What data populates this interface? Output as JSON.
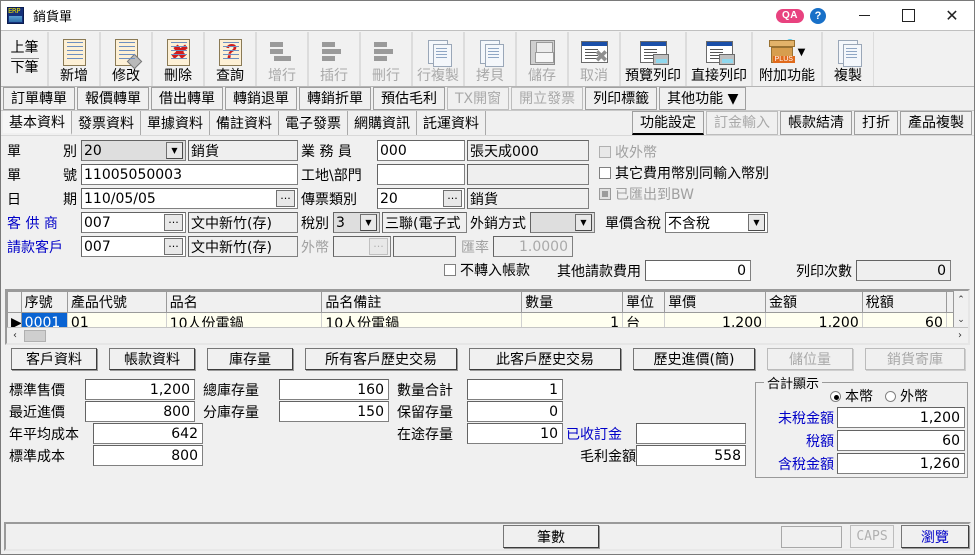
{
  "window": {
    "title": "銷貨單",
    "app_icon": "erp-logo-icon",
    "qa_badge": "QA",
    "help_badge": "?",
    "minimize": "–",
    "maximize": "□",
    "close": "✕"
  },
  "toolbar": [
    {
      "label_top": "上筆",
      "label_bottom": "下筆",
      "icon": "nav-prev-next-icon",
      "enabled": true,
      "kind": "nav"
    },
    {
      "label": "新增",
      "icon": "new-document-icon",
      "enabled": true,
      "kind": "doc"
    },
    {
      "label": "修改",
      "icon": "edit-document-icon",
      "enabled": true,
      "kind": "doc-pen"
    },
    {
      "label": "刪除",
      "icon": "delete-document-icon",
      "enabled": true,
      "kind": "doc-x"
    },
    {
      "label": "查詢",
      "icon": "query-document-icon",
      "enabled": true,
      "kind": "doc-q"
    },
    {
      "label": "增行",
      "icon": "add-row-icon",
      "enabled": false,
      "kind": "rows-add"
    },
    {
      "label": "插行",
      "icon": "insert-row-icon",
      "enabled": false,
      "kind": "rows-ins"
    },
    {
      "label": "刪行",
      "icon": "delete-row-icon",
      "enabled": false,
      "kind": "rows-del"
    },
    {
      "label": "行複製",
      "icon": "copy-row-icon",
      "enabled": false,
      "kind": "copy"
    },
    {
      "label": "拷貝",
      "icon": "clipboard-copy-icon",
      "enabled": false,
      "kind": "save-alt"
    },
    {
      "label": "儲存",
      "icon": "save-icon",
      "enabled": false,
      "kind": "save"
    },
    {
      "label": "取消",
      "icon": "cancel-icon",
      "enabled": false,
      "kind": "win-x"
    },
    {
      "label": "預覽列印",
      "icon": "print-preview-icon",
      "enabled": true,
      "kind": "win-print"
    },
    {
      "label": "直接列印",
      "icon": "print-direct-icon",
      "enabled": true,
      "kind": "win-print"
    },
    {
      "label": "附加功能",
      "icon": "addon-features-icon",
      "enabled": true,
      "kind": "box",
      "has_caret": true
    },
    {
      "label": "複製",
      "icon": "duplicate-icon",
      "enabled": true,
      "kind": "copy2"
    }
  ],
  "tabs_row1": [
    {
      "label": "訂單轉單",
      "enabled": true
    },
    {
      "label": "報價轉單",
      "enabled": true
    },
    {
      "label": "借出轉單",
      "enabled": true
    },
    {
      "label": "轉銷退單",
      "enabled": true
    },
    {
      "label": "轉銷折單",
      "enabled": true
    },
    {
      "label": "預估毛利",
      "enabled": true
    },
    {
      "label": "TX開窗",
      "enabled": false
    },
    {
      "label": "開立發票",
      "enabled": false
    },
    {
      "label": "列印標籤",
      "enabled": true
    },
    {
      "label": "其他功能 ▼",
      "enabled": true
    }
  ],
  "tabs_row2": [
    {
      "label": "基本資料",
      "active": true
    },
    {
      "label": "發票資料",
      "active": false
    },
    {
      "label": "單據資料",
      "active": false
    },
    {
      "label": "備註資料",
      "active": false
    },
    {
      "label": "電子發票",
      "active": false
    },
    {
      "label": "網購資訊",
      "active": false
    },
    {
      "label": "託運資料",
      "active": false
    }
  ],
  "tabs_row2_right": [
    {
      "label": "功能設定",
      "enabled": true
    },
    {
      "label": "訂金輸入",
      "enabled": false
    },
    {
      "label": "帳款結清",
      "enabled": true
    },
    {
      "label": "打折",
      "enabled": true
    },
    {
      "label": "產品複製",
      "enabled": true
    }
  ],
  "form": {
    "doc_type_label": "單　　　別",
    "doc_type_value": "20",
    "doc_type_name": "銷貨",
    "doc_no_label": "單　　　號",
    "doc_no_value": "11005050003",
    "date_label": "日　　　期",
    "date_value": "110/05/05",
    "customer_label": "客 供 商",
    "customer_code": "007",
    "customer_name": "文中新竹(存)",
    "biller_label": "請款客戶",
    "biller_code": "007",
    "biller_name": "文中新竹(存)",
    "salesperson_label": "業 務 員",
    "salesperson_code": "000",
    "salesperson_name": "張天成000",
    "site_label": "工地\\部門",
    "site_code": "",
    "site_name": "",
    "voucher_label": "傳票類別",
    "voucher_code": "20",
    "voucher_name": "銷貨",
    "tax_label": "稅別",
    "tax_code": "3",
    "tax_name": "三聯(電子式",
    "export_label": "外銷方式",
    "export_value": "",
    "currency_label": "外幣",
    "currency_value": "",
    "currency_name": "",
    "rate_label": "匯率",
    "rate_value": "1.0000",
    "price_tax_label": "單價含稅",
    "price_tax_value": "不含稅",
    "chk_recv_foreign": "收外幣",
    "chk_other_fee_currency": "其它費用幣別同輸入幣別",
    "chk_exported_bw": "已匯出到BW",
    "chk_no_transfer": "不轉入帳款",
    "other_fee_label": "其他請款費用",
    "other_fee_value": "0",
    "print_count_label": "列印次數",
    "print_count_value": "0"
  },
  "grid": {
    "columns": [
      "序號",
      "產品代號",
      "品名",
      "品名備註",
      "數量",
      "單位",
      "單價",
      "金額",
      "稅額"
    ],
    "rows": [
      {
        "marker": "▶",
        "seq": "0001",
        "product_code": "01",
        "product_name": "10人份電鍋",
        "product_note": "10人份電鍋",
        "qty": "1",
        "unit": "台",
        "price": "1,200",
        "amount": "1,200",
        "tax": "60"
      }
    ]
  },
  "action_buttons": [
    {
      "label": "客戶資料",
      "enabled": true
    },
    {
      "label": "帳款資料",
      "enabled": true
    },
    {
      "label": "庫存量",
      "enabled": true
    },
    {
      "label": "所有客戶歷史交易",
      "enabled": true
    },
    {
      "label": "此客戶歷史交易",
      "enabled": true
    },
    {
      "label": "歷史進價(簡)",
      "enabled": true
    },
    {
      "label": "儲位量",
      "enabled": false
    },
    {
      "label": "銷貨寄庫",
      "enabled": false
    }
  ],
  "bottom": {
    "std_price_label": "標準售價",
    "std_price_value": "1,200",
    "last_cost_label": "最近進價",
    "last_cost_value": "800",
    "avg_cost_label": "年平均成本",
    "avg_cost_value": "642",
    "std_cost_label": "標準成本",
    "std_cost_value": "800",
    "total_stock_label": "總庫存量",
    "total_stock_value": "160",
    "branch_stock_label": "分庫存量",
    "branch_stock_value": "150",
    "qty_total_label": "數量合計",
    "qty_total_value": "1",
    "reserved_label": "保留存量",
    "reserved_value": "0",
    "intransit_label": "在途存量",
    "intransit_value": "10",
    "deposit_label": "已收訂金",
    "deposit_value": "",
    "gross_profit_label": "毛利金額",
    "gross_profit_value": "558"
  },
  "totals": {
    "legend": "合計顯示",
    "radio_local": "本幣",
    "radio_foreign": "外幣",
    "selected": "本幣",
    "untaxed_label": "未稅金額",
    "untaxed_value": "1,200",
    "tax_label": "稅額",
    "tax_value": "60",
    "taxed_label": "含稅金額",
    "taxed_value": "1,260"
  },
  "statusbar": {
    "count_button": "筆數",
    "count_value": "",
    "caps": "CAPS",
    "browse": "瀏覽"
  },
  "colors": {
    "accent_blue": "#0000c8",
    "selection_blue": "#0a64d2",
    "grid_row_bg": "#fffff0",
    "qa_pink": "#e8427f",
    "chrome_gray": "#f0f0f0"
  }
}
